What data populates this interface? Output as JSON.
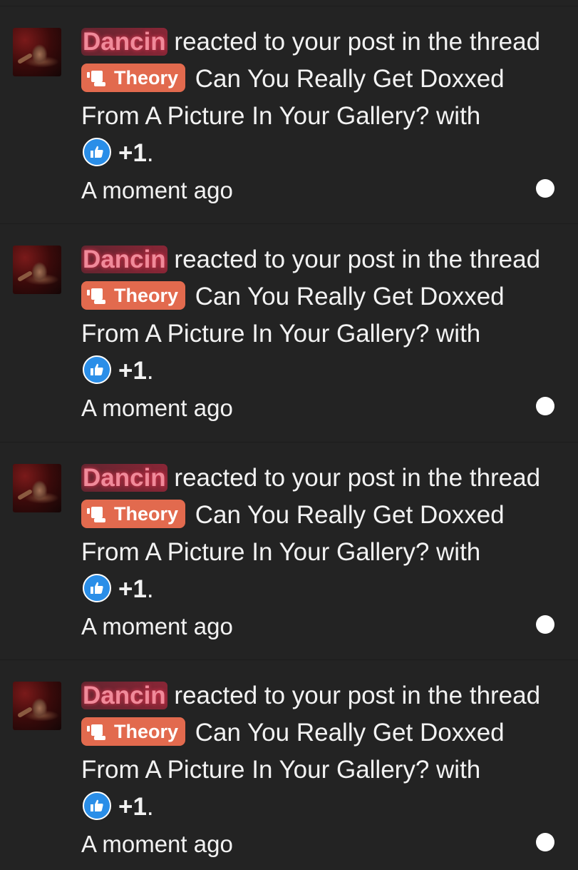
{
  "notifications": [
    {
      "username": "Dancin",
      "action": " reacted to your post in the thread ",
      "prefix": "Theory",
      "thread_title": " Can You Really Get Doxxed From A Picture In Your Gallery?",
      "with_text": " with",
      "reaction_count": "+1",
      "end_punct": ".",
      "time": "A moment ago",
      "reaction_icon": "thumbs-up-icon"
    },
    {
      "username": "Dancin",
      "action": " reacted to your post in the thread ",
      "prefix": "Theory",
      "thread_title": " Can You Really Get Doxxed From A Picture In Your Gallery?",
      "with_text": " with",
      "reaction_count": "+1",
      "end_punct": ".",
      "time": "A moment ago",
      "reaction_icon": "thumbs-up-icon"
    },
    {
      "username": "Dancin",
      "action": " reacted to your post in the thread ",
      "prefix": "Theory",
      "thread_title": " Can You Really Get Doxxed From A Picture In Your Gallery?",
      "with_text": " with",
      "reaction_count": "+1",
      "end_punct": ".",
      "time": "A moment ago",
      "reaction_icon": "thumbs-up-icon"
    },
    {
      "username": "Dancin",
      "action": " reacted to your post in the thread ",
      "prefix": "Theory",
      "thread_title": " Can You Really Get Doxxed From A Picture In Your Gallery?",
      "with_text": " with",
      "reaction_count": "+1",
      "end_punct": ".",
      "time": "A moment ago",
      "reaction_icon": "thumbs-up-icon"
    }
  ],
  "colors": {
    "background": "#232323",
    "prefix_badge": "#e26a4e",
    "reaction_blue": "#2a8ee8",
    "username_highlight": "#dc2846"
  }
}
